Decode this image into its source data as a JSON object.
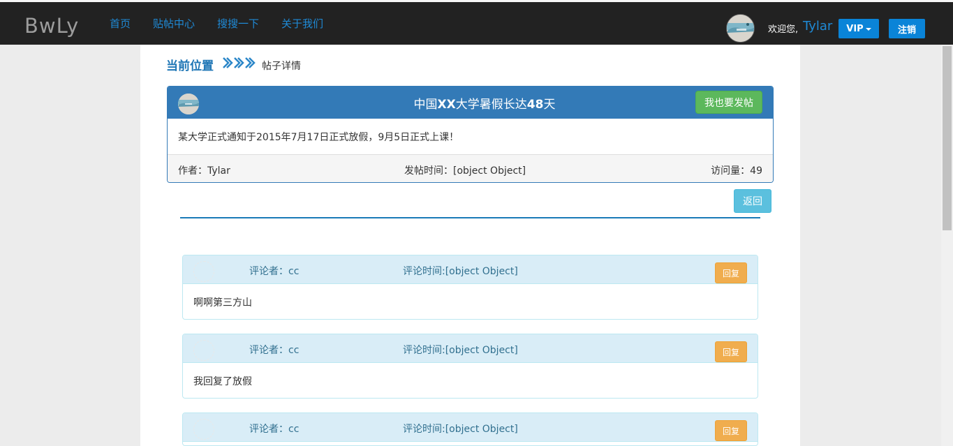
{
  "navbar": {
    "brand": "BwLy",
    "links": [
      "首页",
      "贴帖中心",
      "搜搜一下",
      "关于我们"
    ],
    "welcome": "欢迎您,",
    "username": "Tylar",
    "vip_label": "VIP",
    "logout_label": "注销"
  },
  "breadcrumb": {
    "title": "当前位置",
    "current": "帖子详情"
  },
  "post": {
    "title_parts": [
      "中国",
      "XX",
      "大学暑假长达",
      "48",
      "天"
    ],
    "new_post_label": "我也要发帖",
    "body": "某大学正式通知于2015年7月17日正式放假，9月5日正式上课！",
    "author": "作者：Tylar",
    "time": "发帖时间：[object Object]",
    "views": "访问量：49"
  },
  "back_label": "返回",
  "comments": [
    {
      "author": "评论者：cc",
      "time": "评论时间:[object Object]",
      "reply_label": "回复",
      "body": "啊啊第三方山"
    },
    {
      "author": "评论者：cc",
      "time": "评论时间:[object Object]",
      "reply_label": "回复",
      "body": "我回复了放假"
    },
    {
      "author": "评论者：cc",
      "time": "评论时间:[object Object]",
      "reply_label": "回复",
      "body": ""
    }
  ],
  "colors": {
    "navbar_bg": "#222222",
    "link": "#1f8ad6",
    "primary": "#337ab7",
    "success": "#5cb85c",
    "info": "#5bc0de",
    "warning": "#f0ad4e"
  }
}
